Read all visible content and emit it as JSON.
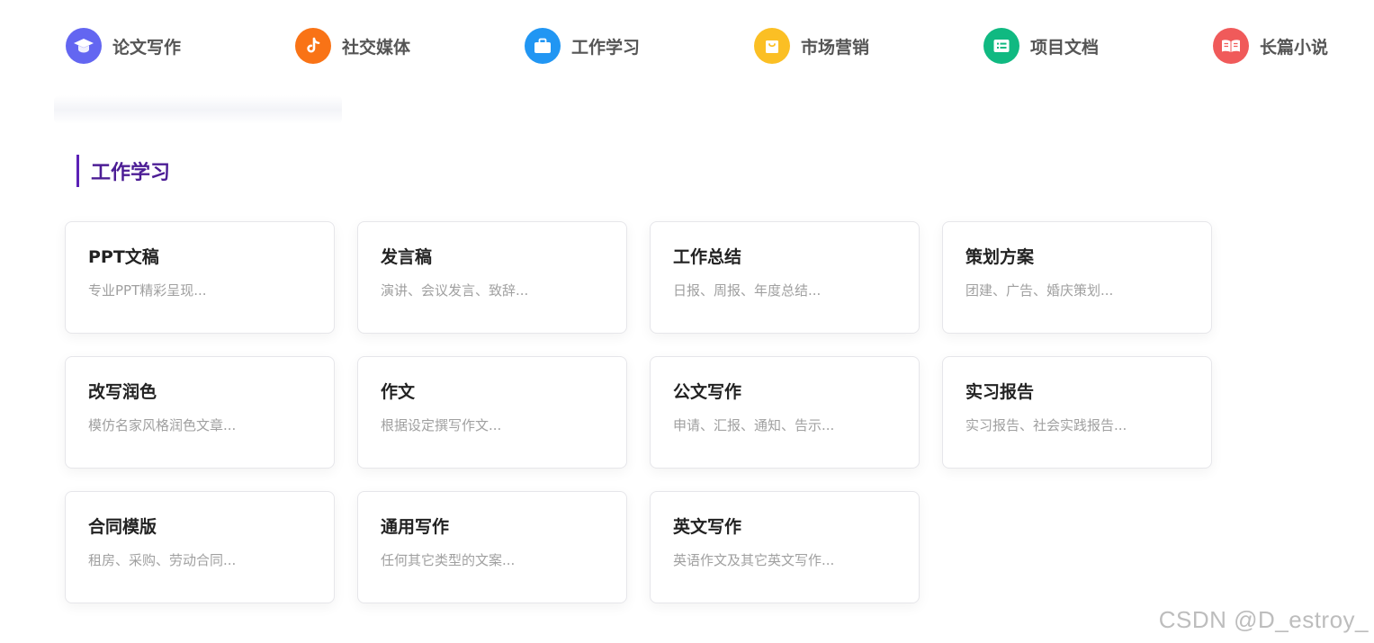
{
  "categories": [
    {
      "label": "论文写作",
      "icon": "graduation-cap-icon",
      "color": "#6366f1"
    },
    {
      "label": "社交媒体",
      "icon": "tiktok-icon",
      "color": "#f97316"
    },
    {
      "label": "工作学习",
      "icon": "briefcase-icon",
      "color": "#2196f3"
    },
    {
      "label": "市场营销",
      "icon": "shopping-bag-icon",
      "color": "#fbbf24"
    },
    {
      "label": "项目文档",
      "icon": "document-list-icon",
      "color": "#10b981"
    },
    {
      "label": "长篇小说",
      "icon": "open-book-icon",
      "color": "#f05a5a"
    }
  ],
  "section": {
    "title": "工作学习",
    "accent": "#5b21b6"
  },
  "cards": [
    {
      "title": "PPT文稿",
      "desc": "专业PPT精彩呈现..."
    },
    {
      "title": "发言稿",
      "desc": "演讲、会议发言、致辞..."
    },
    {
      "title": "工作总结",
      "desc": "日报、周报、年度总结..."
    },
    {
      "title": "策划方案",
      "desc": "团建、广告、婚庆策划..."
    },
    {
      "title": "改写润色",
      "desc": "模仿名家风格润色文章..."
    },
    {
      "title": "作文",
      "desc": "根据设定撰写作文..."
    },
    {
      "title": "公文写作",
      "desc": "申请、汇报、通知、告示..."
    },
    {
      "title": "实习报告",
      "desc": "实习报告、社会实践报告..."
    },
    {
      "title": "合同模版",
      "desc": "租房、采购、劳动合同..."
    },
    {
      "title": "通用写作",
      "desc": "任何其它类型的文案..."
    },
    {
      "title": "英文写作",
      "desc": "英语作文及其它英文写作..."
    }
  ],
  "watermark": "CSDN @D_estroy_"
}
